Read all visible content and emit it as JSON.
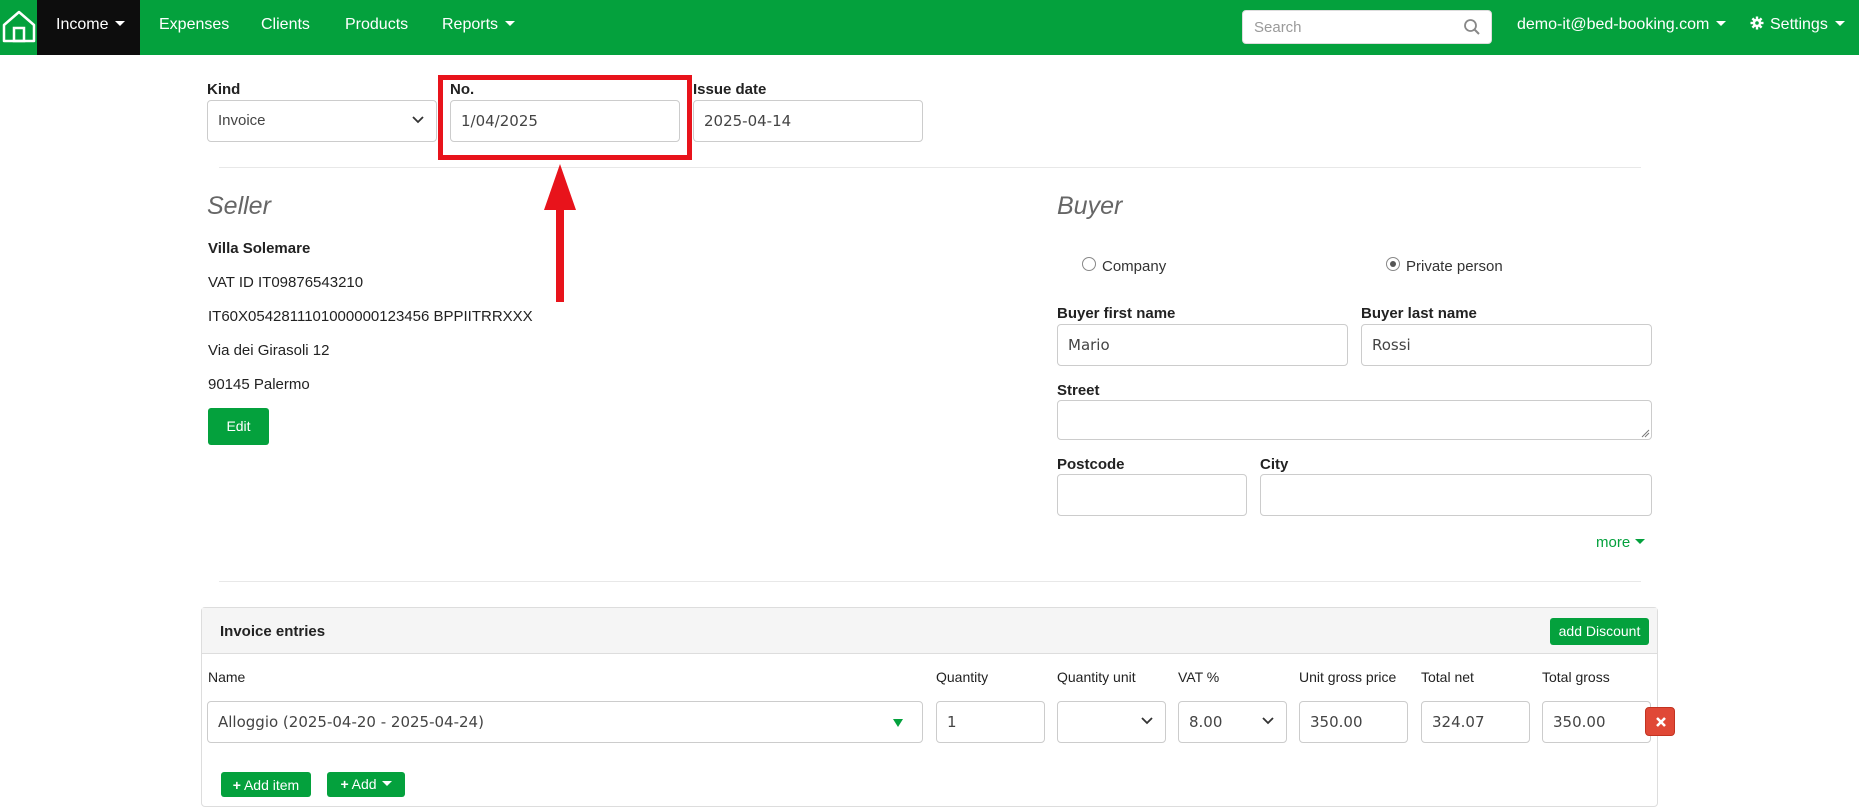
{
  "nav": {
    "items": [
      {
        "label": "Income"
      },
      {
        "label": "Expenses"
      },
      {
        "label": "Clients"
      },
      {
        "label": "Products"
      },
      {
        "label": "Reports"
      }
    ],
    "search_placeholder": "Search",
    "user_email": "demo-it@bed-booking.com",
    "settings_label": "Settings",
    "accent_color": "#04a13d"
  },
  "form": {
    "kind_label": "Kind",
    "kind_value": "Invoice",
    "number_label": "No.",
    "number_value": "1/04/2025",
    "issue_date_label": "Issue date",
    "issue_date_value": "2025-04-14"
  },
  "seller": {
    "title": "Seller",
    "name": "Villa Solemare",
    "vat": "VAT ID IT09876543210",
    "iban": "IT60X0542811101000000123456 BPPIITRRXXX",
    "street": "Via dei Girasoli 12",
    "city": "90145 Palermo",
    "edit_label": "Edit"
  },
  "buyer": {
    "title": "Buyer",
    "type_company": "Company",
    "type_private": "Private person",
    "selected_type": "Private person",
    "first_name_label": "Buyer first name",
    "first_name_value": "Mario",
    "last_name_label": "Buyer last name",
    "last_name_value": "Rossi",
    "street_label": "Street",
    "street_value": "",
    "postcode_label": "Postcode",
    "postcode_value": "",
    "city_label": "City",
    "city_value": "",
    "more_label": "more"
  },
  "entries": {
    "title": "Invoice entries",
    "add_discount_label": "add Discount",
    "columns": [
      "Name",
      "Quantity",
      "Quantity unit",
      "VAT %",
      "Unit gross price",
      "Total net",
      "Total gross"
    ],
    "rows": [
      {
        "name": "Alloggio (2025-04-20 - 2025-04-24)",
        "quantity": "1",
        "unit": "",
        "vat": "8.00",
        "unit_gross": "350.00",
        "total_net": "324.07",
        "total_gross": "350.00"
      }
    ],
    "add_item_label": "Add item",
    "add_label": "Add"
  },
  "annotation": {
    "color": "#e8131b"
  }
}
